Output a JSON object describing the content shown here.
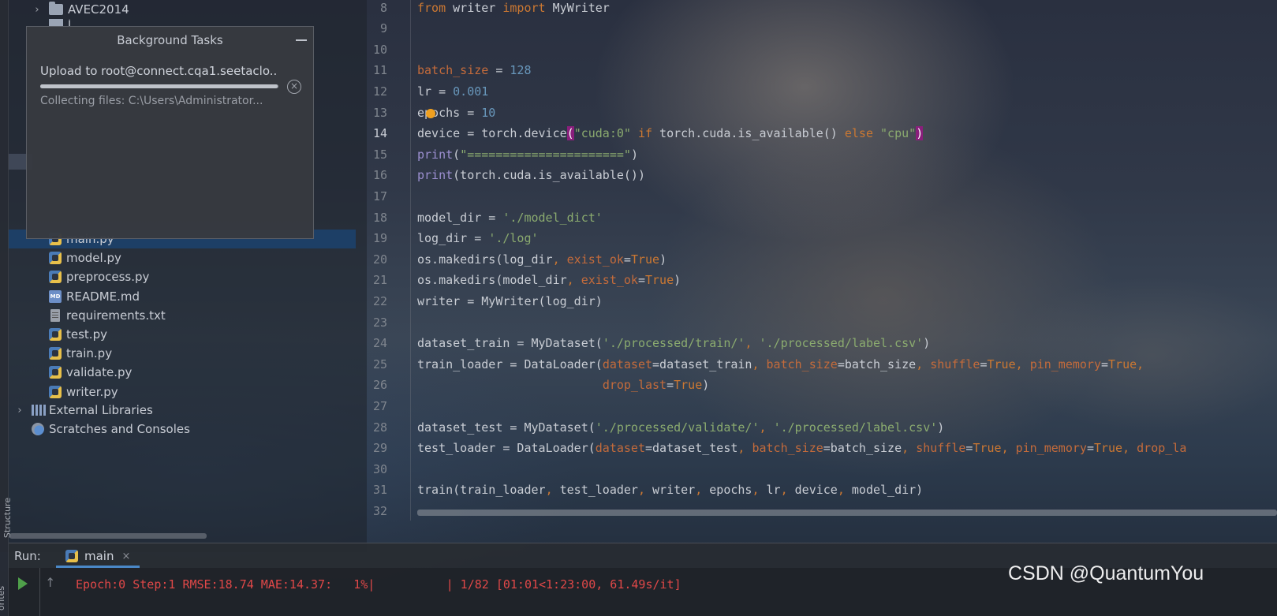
{
  "project_tree": {
    "top_folder": "AVEC2014",
    "partial_item": "i",
    "files": [
      {
        "name": "main.py",
        "type": "py"
      },
      {
        "name": "model.py",
        "type": "py"
      },
      {
        "name": "preprocess.py",
        "type": "py"
      },
      {
        "name": "README.md",
        "type": "md"
      },
      {
        "name": "requirements.txt",
        "type": "txt"
      },
      {
        "name": "test.py",
        "type": "py"
      },
      {
        "name": "train.py",
        "type": "py"
      },
      {
        "name": "validate.py",
        "type": "py"
      },
      {
        "name": "writer.py",
        "type": "py"
      }
    ],
    "external_libraries": "External Libraries",
    "scratches": "Scratches and Consoles",
    "md_badge": "MD"
  },
  "side_labels": {
    "structure": "Structure",
    "favorites": "orites"
  },
  "background_tasks": {
    "title": "Background Tasks",
    "task_title": "Upload to root@connect.cqa1.seetaclo..",
    "task_status": "Collecting files: C:\\Users\\Administrator...",
    "progress_fraction": 0.997,
    "cancel_symbol": "×"
  },
  "editor": {
    "current_line": 14,
    "lines": [
      {
        "n": "8",
        "t": "from writer import MyWriter"
      },
      {
        "n": "9",
        "t": ""
      },
      {
        "n": "10",
        "t": ""
      },
      {
        "n": "11",
        "t": "batch_size = 128"
      },
      {
        "n": "12",
        "t": "lr = 0.001"
      },
      {
        "n": "13",
        "t": "epochs = 10"
      },
      {
        "n": "14",
        "t": "device = torch.device(\"cuda:0\" if torch.cuda.is_available() else \"cpu\")"
      },
      {
        "n": "15",
        "t": "print(\"======================\")"
      },
      {
        "n": "16",
        "t": "print(torch.cuda.is_available())"
      },
      {
        "n": "17",
        "t": ""
      },
      {
        "n": "18",
        "t": "model_dir = './model_dict'"
      },
      {
        "n": "19",
        "t": "log_dir = './log'"
      },
      {
        "n": "20",
        "t": "os.makedirs(log_dir, exist_ok=True)"
      },
      {
        "n": "21",
        "t": "os.makedirs(model_dir, exist_ok=True)"
      },
      {
        "n": "22",
        "t": "writer = MyWriter(log_dir)"
      },
      {
        "n": "23",
        "t": ""
      },
      {
        "n": "24",
        "t": "dataset_train = MyDataset('./processed/train/', './processed/label.csv')"
      },
      {
        "n": "25",
        "t": "train_loader = DataLoader(dataset=dataset_train, batch_size=batch_size, shuffle=True, pin_memory=True,"
      },
      {
        "n": "26",
        "t": "                          drop_last=True)"
      },
      {
        "n": "27",
        "t": ""
      },
      {
        "n": "28",
        "t": "dataset_test = MyDataset('./processed/validate/', './processed/label.csv')"
      },
      {
        "n": "29",
        "t": "test_loader = DataLoader(dataset=dataset_test, batch_size=batch_size, shuffle=True, pin_memory=True, drop_la"
      },
      {
        "n": "30",
        "t": ""
      },
      {
        "n": "31",
        "t": "train(train_loader, test_loader, writer, epochs, lr, device, model_dir)"
      },
      {
        "n": "32",
        "t": ""
      }
    ]
  },
  "run_panel": {
    "label": "Run:",
    "tab_name": "main",
    "tab_close": "×",
    "output": "Epoch:0 Step:1 RMSE:18.74 MAE:14.37:   1%|          | 1/82 [01:01<1:23:00, 61.49s/it]"
  },
  "watermark": "CSDN @QuantumYou",
  "colors": {
    "keyword": "#cc7832",
    "number": "#6897bb",
    "string": "#8bab6f",
    "param": "#c46b3b",
    "builtin": "#9c8fd0",
    "console_error": "#e04848",
    "selection": "#1d3f66"
  }
}
